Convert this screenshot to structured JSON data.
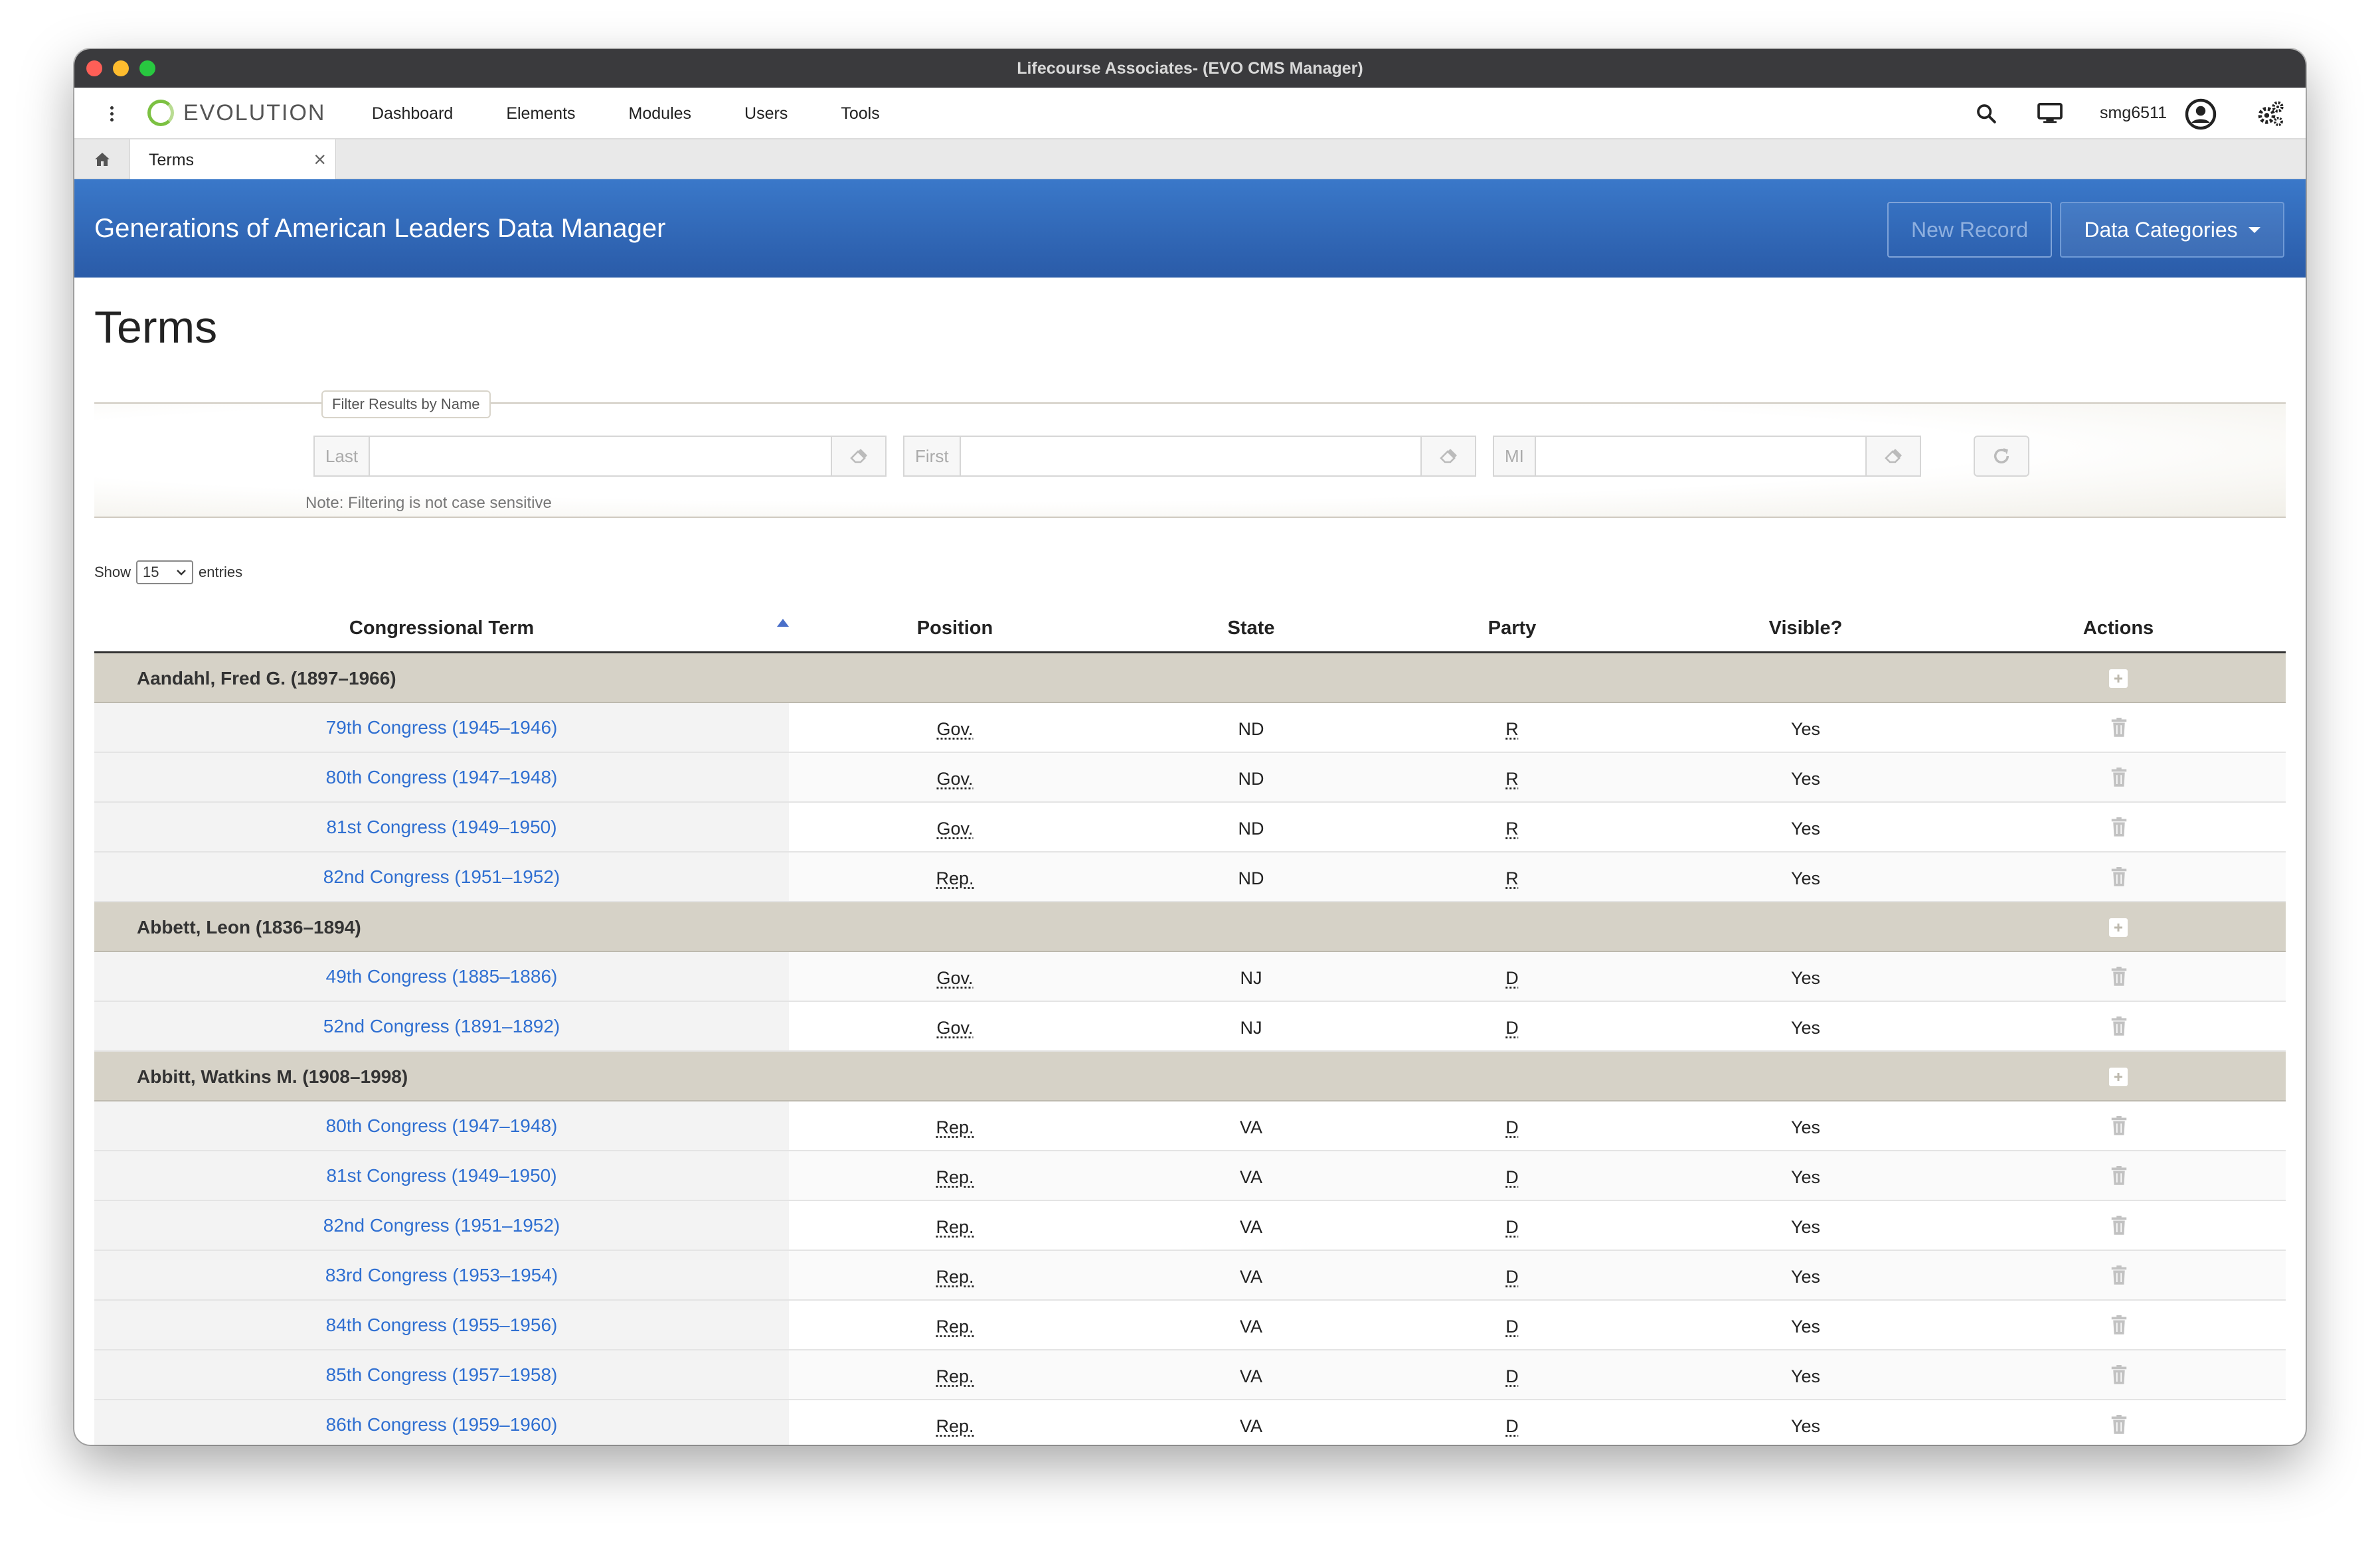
{
  "window": {
    "title": "Lifecourse Associates- (EVO CMS Manager)"
  },
  "nav": {
    "logo": "EVOLUTION",
    "menu": [
      "Dashboard",
      "Elements",
      "Modules",
      "Users",
      "Tools"
    ],
    "username": "smg6511"
  },
  "tabs": {
    "active_label": "Terms",
    "close_glyph": "×"
  },
  "banner": {
    "title": "Generations of American Leaders Data Manager",
    "new_record": "New Record",
    "data_categories": "Data Categories"
  },
  "page": {
    "title": "Terms"
  },
  "filter": {
    "legend": "Filter Results by Name",
    "last_label": "Last",
    "first_label": "First",
    "mi_label": "MI",
    "note": "Note: Filtering is not case sensitive"
  },
  "entries": {
    "show": "Show",
    "value": "15",
    "suffix": "entries"
  },
  "table": {
    "headers": {
      "term": "Congressional Term",
      "position": "Position",
      "state": "State",
      "party": "Party",
      "visible": "Visible?",
      "actions": "Actions"
    },
    "groups": [
      {
        "name": "Aandahl, Fred G. (1897–1966)",
        "rows": [
          {
            "term": "79th Congress (1945–1946)",
            "position": "Gov.",
            "state": "ND",
            "party": "R",
            "visible": "Yes"
          },
          {
            "term": "80th Congress (1947–1948)",
            "position": "Gov.",
            "state": "ND",
            "party": "R",
            "visible": "Yes"
          },
          {
            "term": "81st Congress (1949–1950)",
            "position": "Gov.",
            "state": "ND",
            "party": "R",
            "visible": "Yes"
          },
          {
            "term": "82nd Congress (1951–1952)",
            "position": "Rep.",
            "state": "ND",
            "party": "R",
            "visible": "Yes"
          }
        ]
      },
      {
        "name": "Abbett, Leon (1836–1894)",
        "rows": [
          {
            "term": "49th Congress (1885–1886)",
            "position": "Gov.",
            "state": "NJ",
            "party": "D",
            "visible": "Yes"
          },
          {
            "term": "52nd Congress (1891–1892)",
            "position": "Gov.",
            "state": "NJ",
            "party": "D",
            "visible": "Yes"
          }
        ]
      },
      {
        "name": "Abbitt, Watkins M. (1908–1998)",
        "rows": [
          {
            "term": "80th Congress (1947–1948)",
            "position": "Rep.",
            "state": "VA",
            "party": "D",
            "visible": "Yes"
          },
          {
            "term": "81st Congress (1949–1950)",
            "position": "Rep.",
            "state": "VA",
            "party": "D",
            "visible": "Yes"
          },
          {
            "term": "82nd Congress (1951–1952)",
            "position": "Rep.",
            "state": "VA",
            "party": "D",
            "visible": "Yes"
          },
          {
            "term": "83rd Congress (1953–1954)",
            "position": "Rep.",
            "state": "VA",
            "party": "D",
            "visible": "Yes"
          },
          {
            "term": "84th Congress (1955–1956)",
            "position": "Rep.",
            "state": "VA",
            "party": "D",
            "visible": "Yes"
          },
          {
            "term": "85th Congress (1957–1958)",
            "position": "Rep.",
            "state": "VA",
            "party": "D",
            "visible": "Yes"
          },
          {
            "term": "86th Congress (1959–1960)",
            "position": "Rep.",
            "state": "VA",
            "party": "D",
            "visible": "Yes"
          }
        ]
      }
    ]
  },
  "colors": {
    "brand_blue": "#2f6fd1",
    "banner": "#3a78c9",
    "group_bg": "#d6d2c7",
    "logo_green": "#7cc142"
  }
}
